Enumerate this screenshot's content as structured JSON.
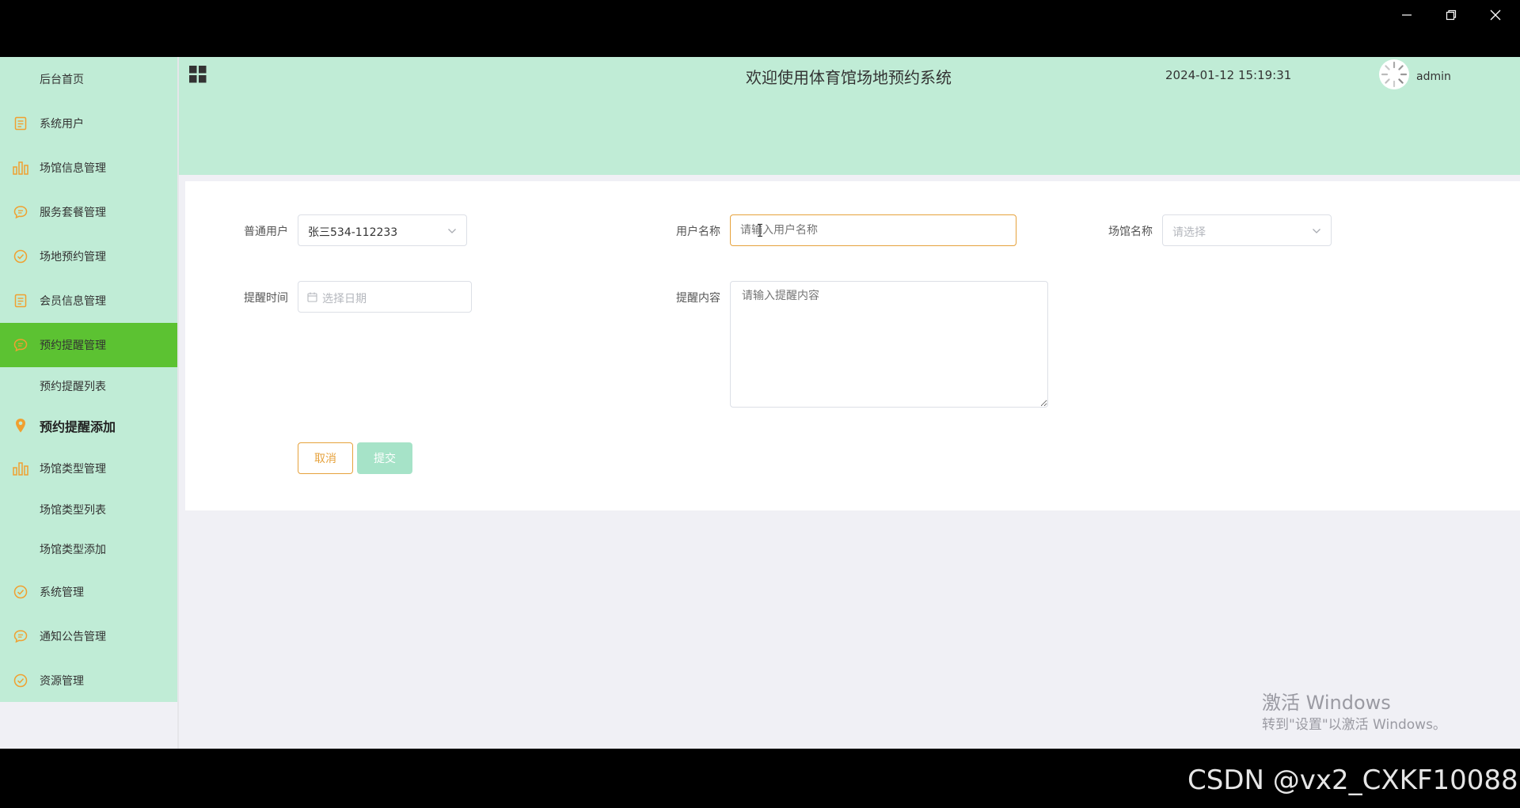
{
  "window": {
    "controls": [
      "minimize-icon",
      "restore-icon",
      "close-icon"
    ]
  },
  "header": {
    "title": "欢迎使用体育馆场地预约系统",
    "datetime": "2024-01-12 15:19:31",
    "username": "admin"
  },
  "sidebar": {
    "items": [
      {
        "label": "后台首页",
        "icon": "none"
      },
      {
        "label": "系统用户",
        "icon": "document-icon"
      },
      {
        "label": "场馆信息管理",
        "icon": "bar-chart-icon"
      },
      {
        "label": "服务套餐管理",
        "icon": "chat-bubble-icon"
      },
      {
        "label": "场地预约管理",
        "icon": "check-circle-icon"
      },
      {
        "label": "会员信息管理",
        "icon": "document-icon"
      },
      {
        "label": "预约提醒管理",
        "icon": "chat-bubble-icon",
        "active": true
      },
      {
        "label": "预约提醒列表",
        "icon": "none"
      },
      {
        "label": "预约提醒添加",
        "icon": "location-pin-icon",
        "current": true
      },
      {
        "label": "场馆类型管理",
        "icon": "bar-chart-icon"
      },
      {
        "label": "场馆类型列表",
        "icon": "none"
      },
      {
        "label": "场馆类型添加",
        "icon": "none"
      },
      {
        "label": "系统管理",
        "icon": "check-circle-icon"
      },
      {
        "label": "通知公告管理",
        "icon": "chat-bubble-icon"
      },
      {
        "label": "资源管理",
        "icon": "check-circle-icon"
      }
    ],
    "accent_color": "#5cc232",
    "icon_color": "#f0a030",
    "bg_color": "#c0ecd6"
  },
  "form": {
    "user_label": "普通用户",
    "user_value": "张三534-112233",
    "username_label": "用户名称",
    "username_placeholder": "请输入用户名称",
    "venue_label": "场馆名称",
    "venue_placeholder": "请选择",
    "time_label": "提醒时间",
    "time_placeholder": "选择日期",
    "content_label": "提醒内容",
    "content_placeholder": "请输入提醒内容",
    "cancel_label": "取消",
    "submit_label": "提交"
  },
  "overlay": {
    "activate_title": "激活 Windows",
    "activate_sub": "转到\"设置\"以激活 Windows。",
    "credit": "CSDN @vx2_CXKF10088"
  }
}
